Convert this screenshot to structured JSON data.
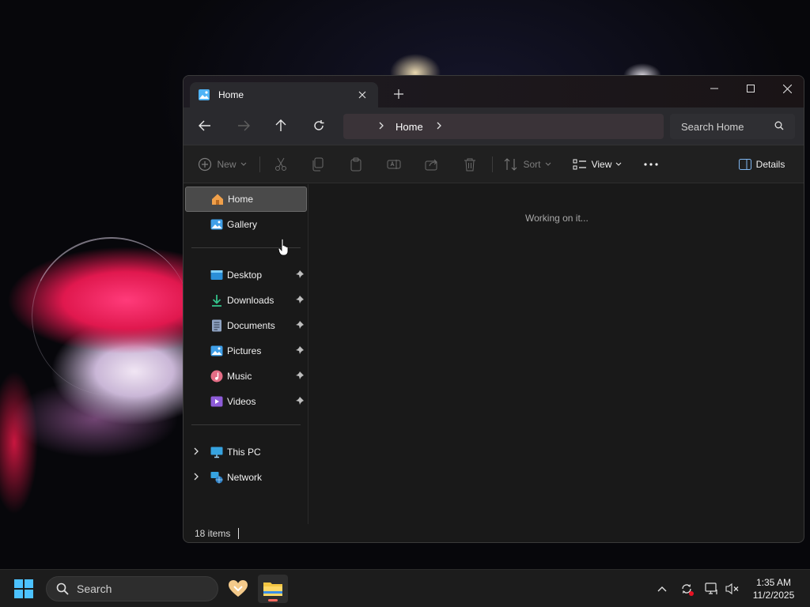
{
  "window": {
    "tab_title": "Home",
    "icons": {
      "tab": "home-picture-icon",
      "new_tab": "plus-icon",
      "minimize": "minimize-icon",
      "maximize": "maximize-icon",
      "close": "close-icon"
    }
  },
  "navigation": {
    "breadcrumb": "Home",
    "search_placeholder": "Search Home"
  },
  "toolbar": {
    "new_label": "New",
    "sort_label": "Sort",
    "view_label": "View",
    "details_label": "Details"
  },
  "sidebar": {
    "top_items": [
      {
        "label": "Home",
        "icon": "home-icon"
      },
      {
        "label": "Gallery",
        "icon": "gallery-icon"
      }
    ],
    "pinned_items": [
      {
        "label": "Desktop",
        "icon": "desktop-folder-icon"
      },
      {
        "label": "Downloads",
        "icon": "downloads-icon"
      },
      {
        "label": "Documents",
        "icon": "documents-icon"
      },
      {
        "label": "Pictures",
        "icon": "pictures-icon"
      },
      {
        "label": "Music",
        "icon": "music-icon"
      },
      {
        "label": "Videos",
        "icon": "videos-icon"
      }
    ],
    "locations": [
      {
        "label": "This PC",
        "icon": "this-pc-icon"
      },
      {
        "label": "Network",
        "icon": "network-icon"
      }
    ]
  },
  "content": {
    "status_message": "Working on it..."
  },
  "statusbar": {
    "item_count": "18 items"
  },
  "taskbar": {
    "search_label": "Search",
    "time": "1:35 AM",
    "date": "11/2/2025"
  },
  "colors": {
    "window_bg": "#191919",
    "accent_folder": "#f4c542",
    "taskbar_indicator": "#ff6a5f"
  }
}
